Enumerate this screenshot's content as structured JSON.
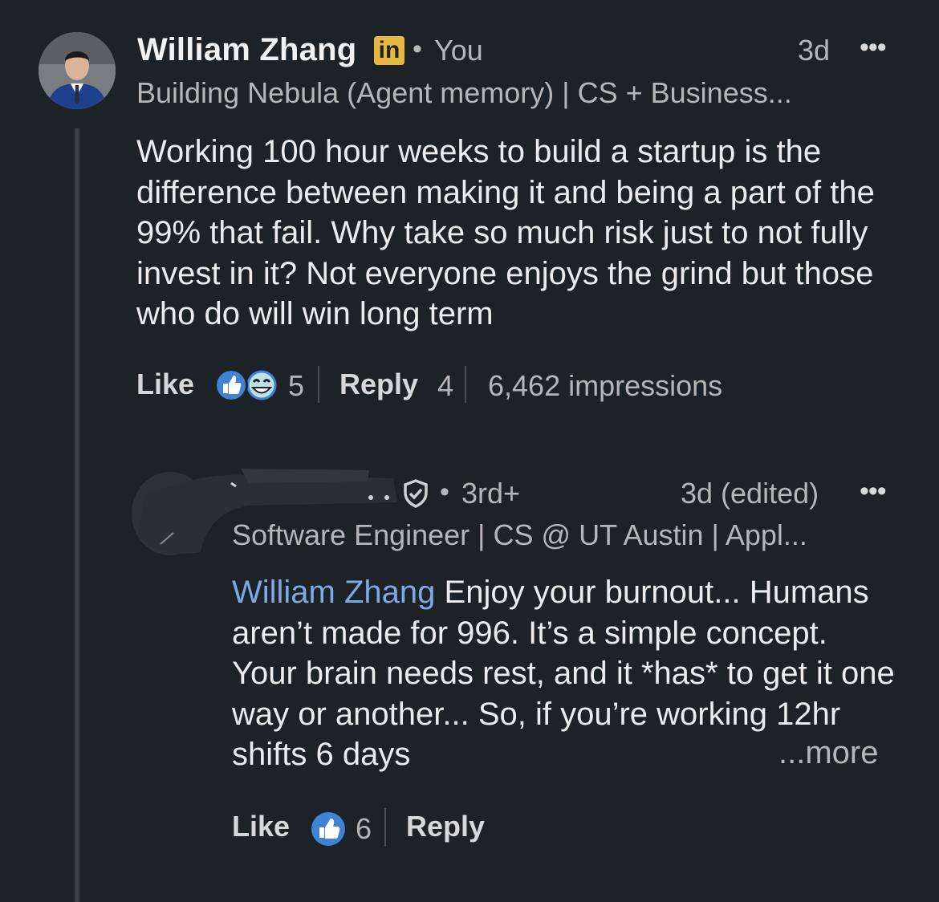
{
  "post": {
    "author_name": "William Zhang",
    "badge": "in",
    "separator": "•",
    "relation": "You",
    "time": "3d",
    "more_icon": "•••",
    "headline": "Building Nebula (Agent memory) | CS + Business...",
    "body": "Working 100 hour weeks to build a startup is the difference between making it and being a part of the 99% that fail. Why take so much risk just to not fully invest in it? Not everyone enjoys the grind but those who do will win long term",
    "like_label": "Like",
    "reaction_count": "5",
    "reply_label": "Reply",
    "reply_count": "4",
    "impressions": "6,462 impressions"
  },
  "reply": {
    "separator": "•",
    "degree": "3rd+",
    "time": "3d (edited)",
    "more_icon": "•••",
    "headline": "Software Engineer | CS @ UT Austin | Appl...",
    "mention": "William Zhang",
    "body": " Enjoy your burnout... Humans aren’t made for 996. It’s a simple concept. Your brain needs rest, and it *has* to get it one way or another... So, if you’re working 12hr shifts 6 days",
    "see_more": "...more",
    "like_label": "Like",
    "reaction_count": "6",
    "reply_label": "Reply"
  },
  "icons": {
    "reaction_like": "thumbs-up-icon",
    "reaction_funny": "laughing-face-icon",
    "verified": "shield-check-icon"
  },
  "colors": {
    "background": "#1d2227",
    "mention": "#7fa8e6",
    "like_blue": "#3f82d6",
    "badge_gold": "#e7b83f"
  }
}
